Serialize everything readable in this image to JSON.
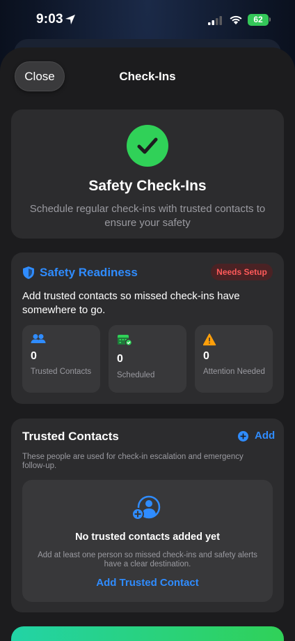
{
  "status_bar": {
    "time": "9:03",
    "battery": "62",
    "battery_color": "#34c759"
  },
  "nav": {
    "close_label": "Close",
    "title": "Check-Ins"
  },
  "hero": {
    "icon": "checkmark-circle-icon",
    "title": "Safety Check-Ins",
    "subtitle": "Schedule regular check-ins with trusted contacts to ensure your safety",
    "accent_color": "#30d158"
  },
  "readiness": {
    "icon": "shield-icon",
    "title": "Safety Readiness",
    "badge": "Needs Setup",
    "badge_color": "#ff5a5a",
    "description": "Add trusted contacts so missed check-ins have somewhere to go.",
    "stats": [
      {
        "icon": "people-icon",
        "value": "0",
        "label": "Trusted Contacts",
        "color": "#2f8cff"
      },
      {
        "icon": "calendar-check-icon",
        "value": "0",
        "label": "Scheduled",
        "color": "#30d158"
      },
      {
        "icon": "warning-icon",
        "value": "0",
        "label": "Attention Needed",
        "color": "#ff9f0a"
      }
    ]
  },
  "contacts": {
    "title": "Trusted Contacts",
    "add_label": "Add",
    "description": "These people are used for check-in escalation and emergency follow-up.",
    "empty": {
      "icon": "add-person-icon",
      "title": "No trusted contacts added yet",
      "description": "Add at least one person so missed check-ins and safety alerts have a clear destination.",
      "cta": "Add Trusted Contact"
    }
  },
  "accent_color": "#2f8cff"
}
